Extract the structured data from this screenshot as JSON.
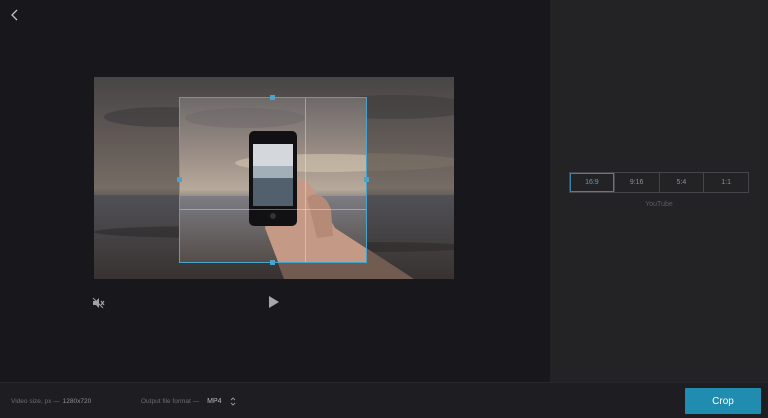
{
  "ratios": [
    {
      "label": "16:9",
      "active": true
    },
    {
      "label": "9:16",
      "active": false
    },
    {
      "label": "5:4",
      "active": false
    },
    {
      "label": "1:1",
      "active": false
    }
  ],
  "preset_label": "YouTube",
  "footer": {
    "video_size_label": "Video size, px —",
    "video_size_value": "1280x720",
    "format_label": "Output file format —",
    "format_value": "MP4"
  },
  "crop_button": "Crop",
  "colors": {
    "accent": "#1f8cb0",
    "crop_border": "#4aa3c8"
  },
  "icons": {
    "back": "chevron-left-icon",
    "mute": "muted-speaker-icon",
    "play": "play-icon",
    "format_select": "chevron-up-down-icon"
  }
}
